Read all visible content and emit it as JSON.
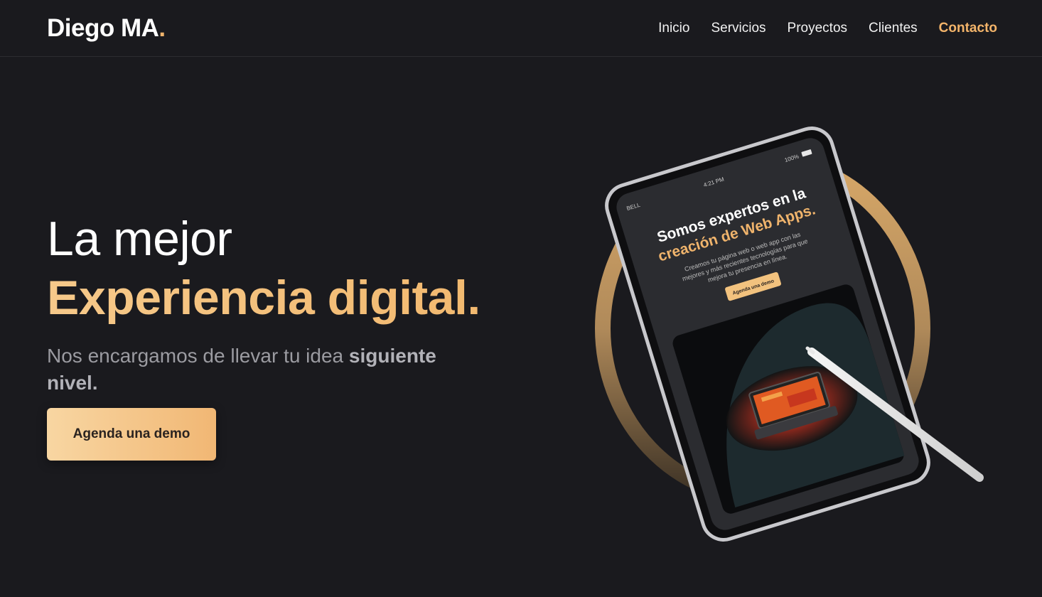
{
  "nav": {
    "brand": "Diego MA",
    "brand_dot": ".",
    "links": [
      {
        "label": "Inicio",
        "active": false
      },
      {
        "label": "Servicios",
        "active": false
      },
      {
        "label": "Proyectos",
        "active": false
      },
      {
        "label": "Clientes",
        "active": false
      },
      {
        "label": "Contacto",
        "active": true
      }
    ]
  },
  "hero": {
    "title_line1": "La mejor",
    "title_line2": "Experiencia digital.",
    "subtitle_plain": "Nos encargamos de llevar tu idea ",
    "subtitle_bold": "siguiente nivel.",
    "cta_label": "Agenda una demo"
  },
  "tablet_screen": {
    "carrier": "BELL",
    "time": "4:21 PM",
    "battery": "100%",
    "headline_1": "Somos expertos en la",
    "headline_2": "creación de Web Apps.",
    "body_1": "Creamos tu página web o web app con las",
    "body_2": "mejores y más recientes tecnologías para que",
    "body_3": "mejora tu presencia en línea.",
    "button": "Agenda una demo"
  },
  "colors": {
    "background": "#1a1a1e",
    "accent": "#f2b86e",
    "accent_light": "#f8d6a2",
    "muted_text": "#9b9ba1"
  }
}
